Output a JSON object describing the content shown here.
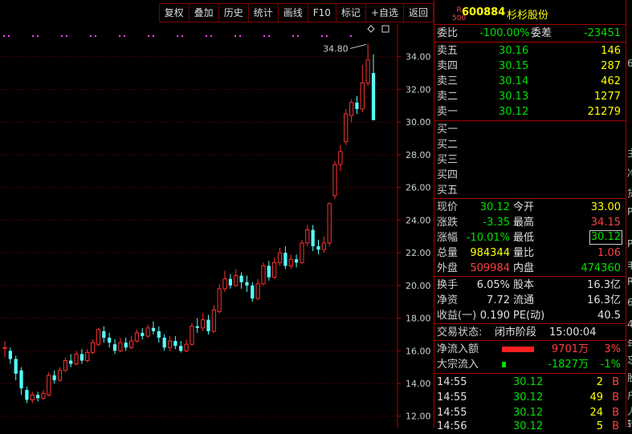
{
  "toolbar": {
    "buttons": [
      "复权",
      "叠加",
      "历史",
      "统计",
      "画线",
      "F10",
      "标记",
      "+自选",
      "返回"
    ]
  },
  "stock": {
    "badge_top": "R",
    "badge_bottom": "500",
    "code": "600884",
    "name": "杉杉股份"
  },
  "order_book": {
    "weibi": {
      "label": "委比",
      "value": "-100.00%",
      "label2": "委差",
      "value2": "-23451"
    },
    "asks": [
      {
        "label": "卖五",
        "price": "30.16",
        "vol": "146"
      },
      {
        "label": "卖四",
        "price": "30.15",
        "vol": "287"
      },
      {
        "label": "卖三",
        "price": "30.14",
        "vol": "462"
      },
      {
        "label": "卖二",
        "price": "30.13",
        "vol": "1277"
      },
      {
        "label": "卖一",
        "price": "30.12",
        "vol": "21279"
      }
    ],
    "bids": [
      {
        "label": "买一"
      },
      {
        "label": "买二"
      },
      {
        "label": "买三"
      },
      {
        "label": "买四"
      },
      {
        "label": "买五"
      }
    ]
  },
  "quote": {
    "rows": [
      {
        "l1": "现价",
        "v1": "30.12",
        "l2": "今开",
        "v2": "33.00"
      },
      {
        "l1": "涨跌",
        "v1": "-3.35",
        "l2": "最高",
        "v2": "34.15"
      },
      {
        "l1": "涨幅",
        "v1": "-10.01%",
        "l2": "最低",
        "v2": "30.12"
      },
      {
        "l1": "总量",
        "v1": "984344",
        "l2": "量比",
        "v2": "1.06"
      },
      {
        "l1": "外盘",
        "v1": "509984",
        "l2": "内盘",
        "v2": "474360"
      }
    ]
  },
  "fundamentals": {
    "rows": [
      {
        "l1": "换手",
        "v1": "6.05%",
        "l2": "股本",
        "v2": "16.3亿"
      },
      {
        "l1": "净资",
        "v1": "7.72",
        "l2": "流通",
        "v2": "16.3亿"
      },
      {
        "l1": "收益(一)",
        "v1": "0.190",
        "l2": "PE(动)",
        "v2": "40.5"
      }
    ]
  },
  "status": {
    "label": "交易状态:",
    "value": "闭市阶段",
    "time": "15:00:04"
  },
  "flows": [
    {
      "label": "净流入额",
      "value": "9701万",
      "pct": "3%",
      "bar": 0.8
    },
    {
      "label": "大宗流入",
      "value": "-1827万",
      "pct": "-1%",
      "bar": 0.1
    }
  ],
  "ticks": [
    {
      "time": "14:55",
      "price": "30.12",
      "vol": "2",
      "side": "B"
    },
    {
      "time": "14:55",
      "price": "30.12",
      "vol": "49",
      "side": "B"
    },
    {
      "time": "14:55",
      "price": "30.12",
      "vol": "24",
      "side": "B"
    },
    {
      "time": "14:56",
      "price": "30.12",
      "vol": "5",
      "side": "B"
    }
  ],
  "right_edge": [
    "6",
    "主",
    "冷",
    "货",
    "P",
    "P",
    "毛",
    "R",
    "6",
    "4",
    "年",
    "忘",
    "股",
    "户",
    "人",
    "转"
  ],
  "colors": {
    "up": "#ff3030",
    "down": "#54ffff",
    "grid": "#7a0000",
    "axis": "#c00000"
  },
  "chart_data": {
    "type": "candlestick",
    "y_ticks": [
      "12.00",
      "14.00",
      "16.00",
      "18.00",
      "20.00",
      "22.00",
      "24.00",
      "26.00",
      "28.00",
      "30.00",
      "32.00",
      "34.00"
    ],
    "ylim": [
      11.3,
      36.0
    ],
    "high_label": "34.80",
    "candles": [
      [
        16.2,
        16.2,
        16.6,
        15.6
      ],
      [
        16.0,
        15.5,
        16.2,
        15.2
      ],
      [
        15.5,
        14.6,
        15.7,
        14.2
      ],
      [
        14.8,
        13.7,
        15.0,
        13.3
      ],
      [
        13.6,
        13.0,
        13.8,
        12.8
      ],
      [
        13.0,
        13.3,
        13.5,
        12.8
      ],
      [
        13.3,
        13.1,
        13.5,
        12.9
      ],
      [
        13.1,
        13.4,
        13.6,
        13.0
      ],
      [
        13.3,
        14.5,
        14.7,
        13.2
      ],
      [
        14.5,
        14.2,
        14.8,
        14.0
      ],
      [
        14.2,
        14.8,
        15.0,
        14.1
      ],
      [
        14.8,
        15.4,
        15.6,
        14.7
      ],
      [
        15.4,
        15.2,
        15.8,
        15.0
      ],
      [
        15.2,
        15.8,
        16.0,
        15.1
      ],
      [
        15.8,
        15.4,
        16.1,
        15.2
      ],
      [
        15.4,
        15.9,
        16.1,
        15.3
      ],
      [
        15.9,
        16.5,
        16.7,
        15.8
      ],
      [
        16.4,
        17.3,
        17.4,
        16.3
      ],
      [
        17.2,
        16.8,
        17.5,
        16.5
      ],
      [
        16.8,
        16.5,
        17.1,
        16.2
      ],
      [
        16.4,
        16.0,
        16.7,
        15.8
      ],
      [
        16.0,
        16.5,
        16.8,
        15.9
      ],
      [
        16.5,
        16.2,
        16.8,
        16.0
      ],
      [
        16.2,
        16.6,
        16.9,
        16.1
      ],
      [
        16.6,
        17.1,
        17.3,
        16.5
      ],
      [
        17.1,
        16.9,
        17.4,
        16.7
      ],
      [
        16.9,
        17.4,
        17.6,
        16.8
      ],
      [
        17.4,
        17.2,
        17.8,
        17.0
      ],
      [
        17.2,
        16.8,
        17.5,
        16.5
      ],
      [
        16.8,
        16.2,
        17.0,
        16.0
      ],
      [
        16.2,
        16.6,
        16.9,
        16.0
      ],
      [
        16.6,
        16.3,
        16.9,
        16.1
      ],
      [
        16.3,
        16.0,
        16.6,
        15.9
      ],
      [
        16.0,
        16.4,
        16.7,
        15.9
      ],
      [
        16.4,
        17.5,
        17.7,
        16.3
      ],
      [
        17.5,
        17.4,
        18.0,
        17.1
      ],
      [
        17.4,
        17.9,
        18.3,
        17.2
      ],
      [
        17.9,
        17.2,
        18.2,
        17.0
      ],
      [
        17.2,
        18.5,
        18.8,
        17.1
      ],
      [
        18.4,
        19.8,
        20.1,
        18.3
      ],
      [
        19.8,
        20.4,
        20.9,
        19.6
      ],
      [
        20.4,
        20.0,
        20.7,
        19.8
      ],
      [
        20.0,
        20.6,
        21.0,
        19.9
      ],
      [
        20.6,
        20.2,
        20.8,
        19.8
      ],
      [
        20.2,
        20.0,
        20.6,
        19.6
      ],
      [
        20.0,
        19.2,
        20.2,
        19.0
      ],
      [
        19.2,
        20.1,
        20.4,
        19.1
      ],
      [
        20.1,
        21.2,
        21.4,
        20.0
      ],
      [
        21.2,
        20.5,
        21.5,
        20.3
      ],
      [
        20.5,
        21.4,
        21.7,
        20.4
      ],
      [
        21.4,
        22.0,
        22.3,
        21.2
      ],
      [
        22.0,
        21.2,
        22.4,
        21.0
      ],
      [
        21.2,
        21.6,
        21.9,
        21.0
      ],
      [
        21.6,
        21.4,
        21.9,
        21.1
      ],
      [
        21.4,
        22.6,
        22.8,
        21.3
      ],
      [
        22.6,
        23.4,
        23.7,
        22.4
      ],
      [
        23.4,
        22.4,
        23.7,
        22.1
      ],
      [
        22.4,
        22.2,
        22.8,
        21.9
      ],
      [
        22.2,
        22.6,
        23.0,
        22.0
      ],
      [
        22.6,
        25.0,
        25.1,
        22.4
      ],
      [
        25.5,
        27.4,
        27.6,
        25.3
      ],
      [
        27.4,
        28.2,
        28.6,
        27.0
      ],
      [
        28.8,
        30.5,
        30.8,
        28.6
      ],
      [
        30.4,
        31.2,
        31.4,
        30.0
      ],
      [
        31.2,
        30.8,
        31.6,
        30.5
      ],
      [
        30.8,
        32.4,
        33.5,
        30.6
      ],
      [
        32.4,
        33.8,
        34.8,
        32.2
      ],
      [
        33.0,
        30.12,
        34.15,
        30.12
      ]
    ]
  }
}
